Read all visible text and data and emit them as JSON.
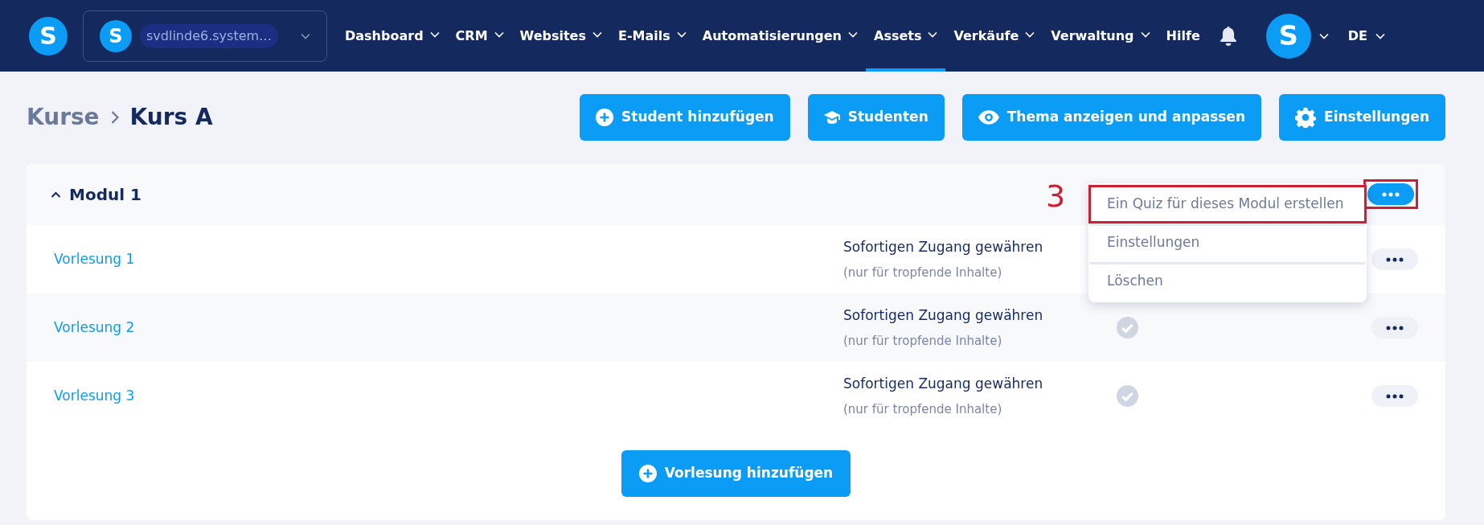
{
  "nav": {
    "logo": "S",
    "workspace": {
      "avatar": "S",
      "name": "svdlinde6.system…"
    },
    "items": [
      {
        "label": "Dashboard",
        "dropdown": true,
        "selected": false
      },
      {
        "label": "CRM",
        "dropdown": true,
        "selected": false
      },
      {
        "label": "Websites",
        "dropdown": true,
        "selected": false
      },
      {
        "label": "E-Mails",
        "dropdown": true,
        "selected": false
      },
      {
        "label": "Automatisierungen",
        "dropdown": true,
        "selected": false
      },
      {
        "label": "Assets",
        "dropdown": true,
        "selected": true
      },
      {
        "label": "Verkäufe",
        "dropdown": true,
        "selected": false
      },
      {
        "label": "Verwaltung",
        "dropdown": true,
        "selected": false
      },
      {
        "label": "Hilfe",
        "dropdown": false,
        "selected": false
      }
    ],
    "avatar": "S",
    "language": "DE"
  },
  "breadcrumb": [
    "Kurse",
    "Kurs A"
  ],
  "actions": [
    {
      "kind": "plus",
      "label": "Student hinzufügen"
    },
    {
      "kind": "cap",
      "label": "Studenten"
    },
    {
      "kind": "eye",
      "label": "Thema anzeigen und anpassen"
    },
    {
      "kind": "gear",
      "label": "Einstellungen"
    }
  ],
  "module": {
    "title": "Modul 1",
    "expanded": true,
    "menu_button_highlighted": true,
    "step_marker": "3",
    "menu": [
      {
        "label": "Ein Quiz für dieses Modul erstellen",
        "highlighted": true
      },
      {
        "label": "Einstellungen",
        "highlighted": false
      },
      {
        "label": "Löschen",
        "highlighted": false
      }
    ],
    "lectures": [
      {
        "title": "Vorlesung 1",
        "access": "Sofortigen Zugang gewähren",
        "note": "(nur für tropfende Inhalte)"
      },
      {
        "title": "Vorlesung 2",
        "access": "Sofortigen Zugang gewähren",
        "note": "(nur für tropfende Inhalte)",
        "checked": false
      },
      {
        "title": "Vorlesung 3",
        "access": "Sofortigen Zugang gewähren",
        "note": "(nur für tropfende Inhalte)",
        "checked": false
      }
    ],
    "add_button": "Vorlesung hinzufügen"
  }
}
